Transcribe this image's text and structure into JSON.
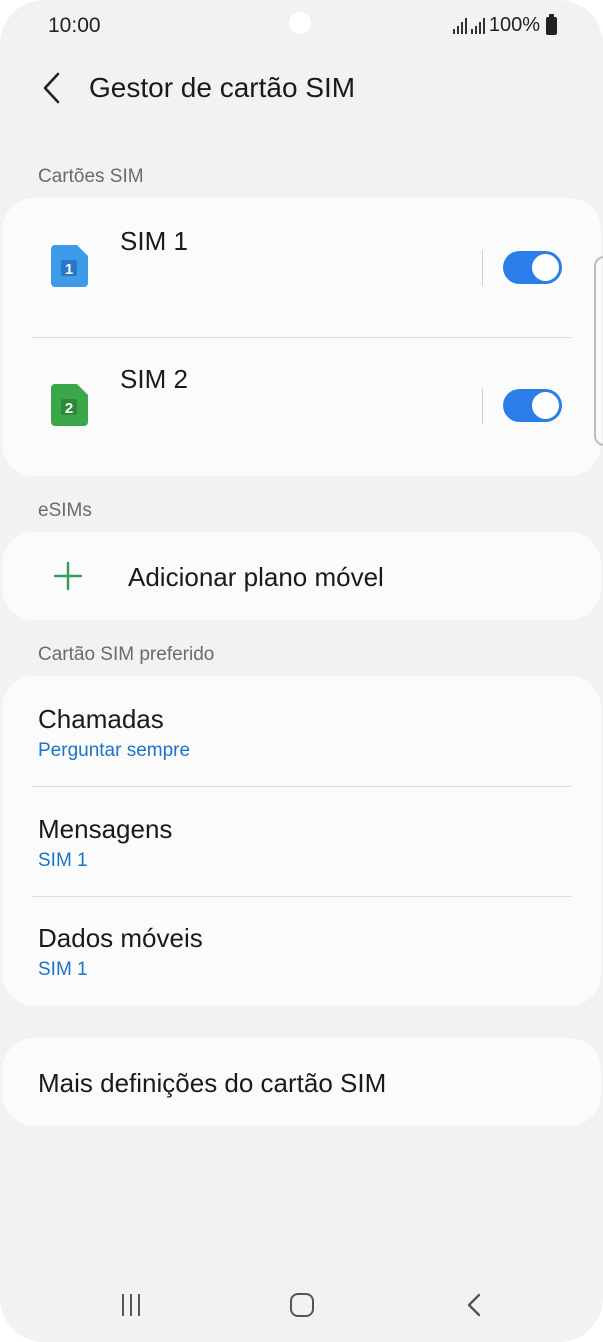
{
  "status_bar": {
    "time": "10:00",
    "battery": "100%"
  },
  "header": {
    "title": "Gestor de cartão SIM"
  },
  "sim_section": {
    "label": "Cartões SIM",
    "sims": [
      {
        "name": "SIM 1",
        "icon_number": "1",
        "icon_color": "#3d9be9",
        "enabled": true
      },
      {
        "name": "SIM 2",
        "icon_number": "2",
        "icon_color": "#3aa84a",
        "enabled": true
      }
    ]
  },
  "esim_section": {
    "label": "eSIMs",
    "add_plan": "Adicionar plano móvel"
  },
  "preferred_section": {
    "label": "Cartão SIM preferido",
    "items": [
      {
        "title": "Chamadas",
        "value": "Perguntar sempre"
      },
      {
        "title": "Mensagens",
        "value": "SIM 1"
      },
      {
        "title": "Dados móveis",
        "value": "SIM 1"
      }
    ]
  },
  "more_settings": {
    "label": "Mais definições do cartão SIM"
  },
  "colors": {
    "accent": "#2b7de9",
    "link": "#1d72c9",
    "plus": "#2e9e5a",
    "background": "#f2f2f2",
    "card": "#fbfbfb"
  }
}
